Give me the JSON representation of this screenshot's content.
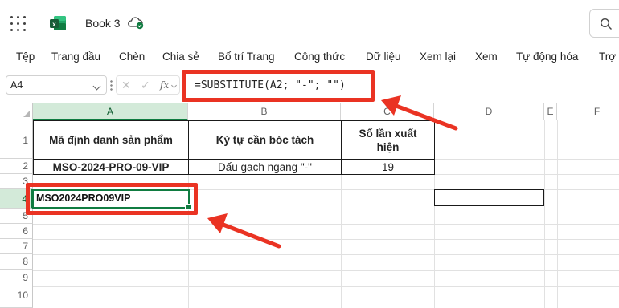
{
  "app": {
    "book_title": "Book 3",
    "icons": [
      "app-launcher-icon",
      "excel-logo-icon",
      "cloud-saved-icon",
      "search-icon"
    ]
  },
  "ribbon": {
    "tabs": [
      "Tệp",
      "Trang đầu",
      "Chèn",
      "Chia sẻ",
      "Bố trí Trang",
      "Công thức",
      "Dữ liệu",
      "Xem lại",
      "Xem",
      "Tự động hóa",
      "Trợ g"
    ]
  },
  "formula_bar": {
    "name_box": "A4",
    "fx_label": "fx",
    "formula": "=SUBSTITUTE(A2; \"-\"; \"\")"
  },
  "sheet": {
    "columns": [
      "A",
      "B",
      "C",
      "D",
      "E",
      "F"
    ],
    "rows": [
      "1",
      "2",
      "3",
      "4",
      "5",
      "6",
      "7",
      "8",
      "9",
      "10"
    ],
    "selected_cell": "A4",
    "header": {
      "a1": "Mã định danh sản phẩm",
      "b1": "Ký tự cần bóc tách",
      "c1": "Số lần xuất hiện"
    },
    "row2": {
      "a2": "MSO-2024-PRO-09-VIP",
      "b2": "Dấu gạch ngang \"-\"",
      "c2": "19"
    },
    "row4": {
      "a4": "MSO2024PRO09VIP"
    }
  },
  "colors": {
    "accent_green": "#107c41",
    "annotation_red": "#ea3323",
    "excel_green": "#185c37"
  }
}
